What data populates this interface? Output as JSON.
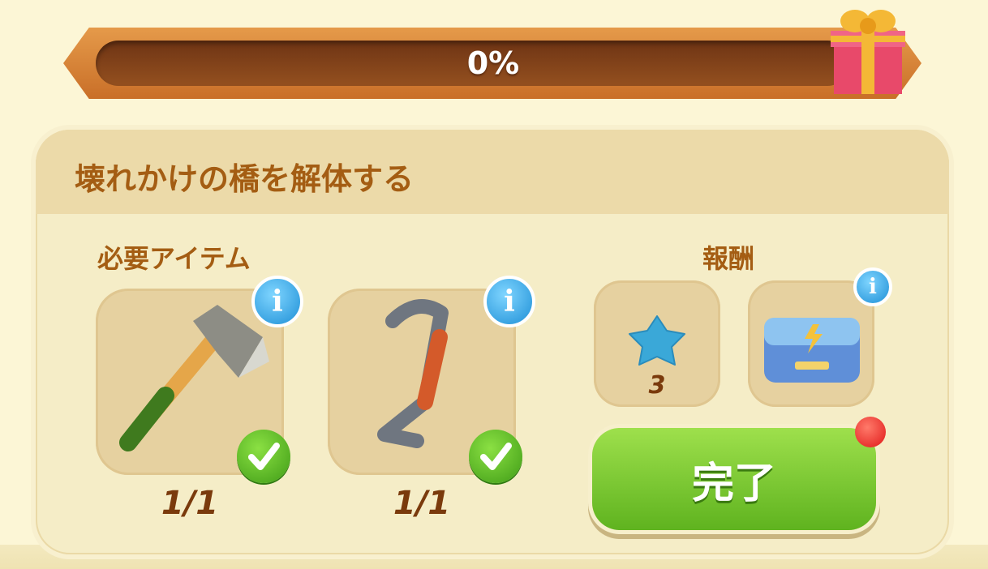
{
  "progress": {
    "label": "0%",
    "value": 0
  },
  "quest": {
    "title": "壊れかけの橋を解体する",
    "required_label": "必要アイテム",
    "reward_label": "報酬",
    "items": [
      {
        "name": "axe",
        "count": "1/1",
        "status": "complete"
      },
      {
        "name": "crowbar",
        "count": "1/1",
        "status": "complete"
      }
    ],
    "rewards": [
      {
        "name": "blue-star",
        "count": "3"
      },
      {
        "name": "energy-chest",
        "count": ""
      }
    ],
    "complete_label": "完了"
  },
  "colors": {
    "title": "#a45d13",
    "button": "#6fbf2a",
    "info": "#1e8fd6",
    "bar": "#b2642a"
  }
}
